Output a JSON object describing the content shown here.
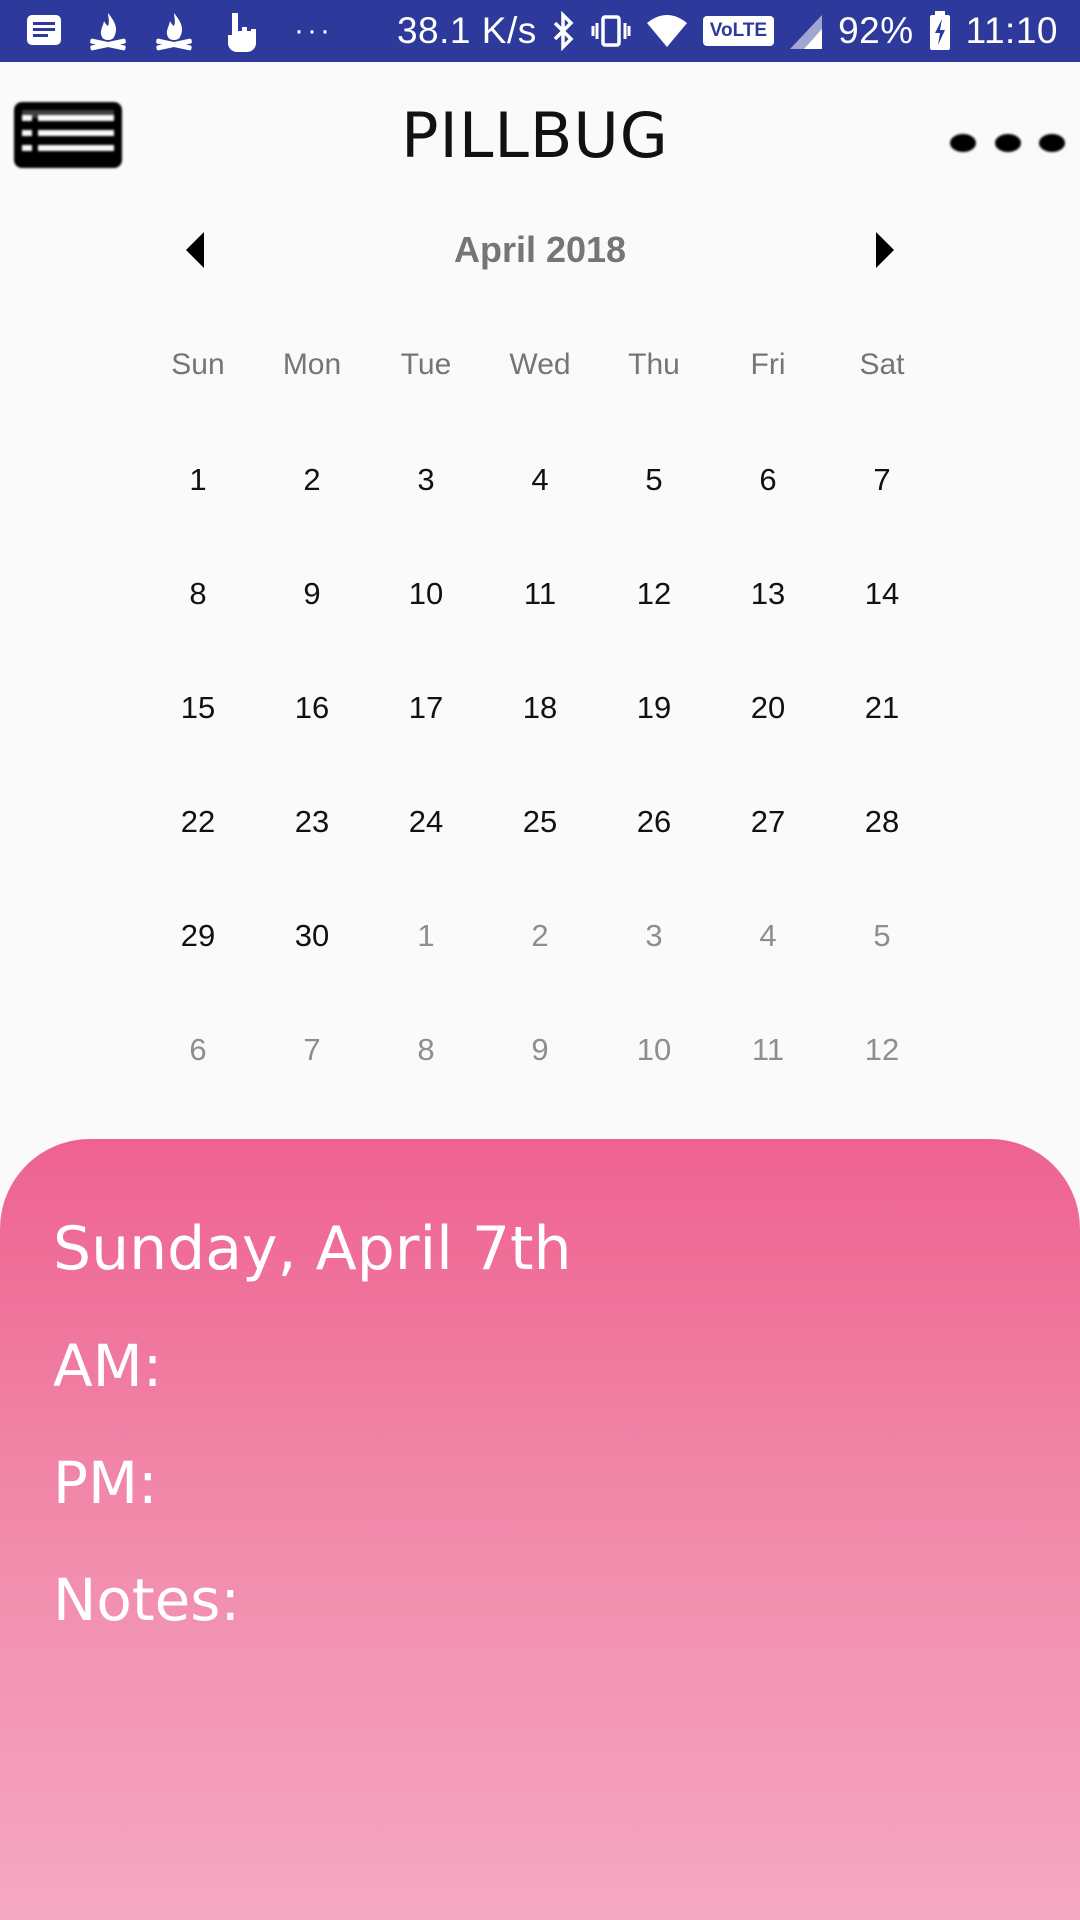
{
  "status_bar": {
    "dots": "···",
    "network_speed": "38.1 K/s",
    "volte_label": "VoLTE",
    "battery_percent": "92%",
    "time": "11:10",
    "icons": [
      "message-icon",
      "fire-icon",
      "fire-icon",
      "touch-icon",
      "bluetooth-icon",
      "vibrate-icon",
      "wifi-icon",
      "signal-icon",
      "battery-charging-icon"
    ]
  },
  "app_bar": {
    "title": "PILLBUG",
    "menu_icon": "list-menu-icon",
    "overflow_icon": "more-dots-icon"
  },
  "calendar": {
    "month_label": "April 2018",
    "prev_icon": "chevron-left-icon",
    "next_icon": "chevron-right-icon",
    "weekdays": [
      "Sun",
      "Mon",
      "Tue",
      "Wed",
      "Thu",
      "Fri",
      "Sat"
    ],
    "days": [
      {
        "label": "1",
        "current": true
      },
      {
        "label": "2",
        "current": true
      },
      {
        "label": "3",
        "current": true
      },
      {
        "label": "4",
        "current": true
      },
      {
        "label": "5",
        "current": true
      },
      {
        "label": "6",
        "current": true
      },
      {
        "label": "7",
        "current": true
      },
      {
        "label": "8",
        "current": true
      },
      {
        "label": "9",
        "current": true
      },
      {
        "label": "10",
        "current": true
      },
      {
        "label": "11",
        "current": true
      },
      {
        "label": "12",
        "current": true
      },
      {
        "label": "13",
        "current": true
      },
      {
        "label": "14",
        "current": true
      },
      {
        "label": "15",
        "current": true
      },
      {
        "label": "16",
        "current": true
      },
      {
        "label": "17",
        "current": true
      },
      {
        "label": "18",
        "current": true
      },
      {
        "label": "19",
        "current": true
      },
      {
        "label": "20",
        "current": true
      },
      {
        "label": "21",
        "current": true
      },
      {
        "label": "22",
        "current": true
      },
      {
        "label": "23",
        "current": true
      },
      {
        "label": "24",
        "current": true
      },
      {
        "label": "25",
        "current": true
      },
      {
        "label": "26",
        "current": true
      },
      {
        "label": "27",
        "current": true
      },
      {
        "label": "28",
        "current": true
      },
      {
        "label": "29",
        "current": true
      },
      {
        "label": "30",
        "current": true
      },
      {
        "label": "1",
        "current": false
      },
      {
        "label": "2",
        "current": false
      },
      {
        "label": "3",
        "current": false
      },
      {
        "label": "4",
        "current": false
      },
      {
        "label": "5",
        "current": false
      },
      {
        "label": "6",
        "current": false
      },
      {
        "label": "7",
        "current": false
      },
      {
        "label": "8",
        "current": false
      },
      {
        "label": "9",
        "current": false
      },
      {
        "label": "10",
        "current": false
      },
      {
        "label": "11",
        "current": false
      },
      {
        "label": "12",
        "current": false
      }
    ]
  },
  "detail": {
    "date_label": "Sunday, April 7th",
    "am_label": "AM:",
    "am_value": "",
    "pm_label": "PM:",
    "pm_value": "",
    "notes_label": "Notes:",
    "notes_value": ""
  },
  "colors": {
    "status_bar": "#2d3a9c",
    "background": "#fafafa",
    "sheet_top": "#ee6290",
    "sheet_bottom": "#f5a8c2",
    "muted_text": "#757575"
  }
}
